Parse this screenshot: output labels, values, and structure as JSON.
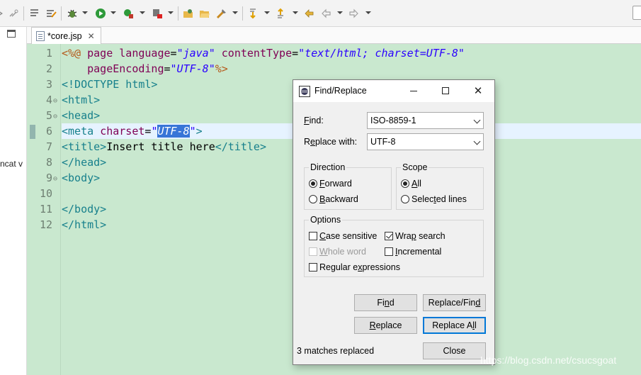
{
  "toolbar": {
    "icons": [
      "collapse-icon",
      "link-icon",
      "outline-icon",
      "task-icon",
      "debug-icon",
      "run-icon",
      "external-run-icon",
      "stop-server-icon",
      "open-type-icon",
      "open-folder-icon",
      "run-ant-icon",
      "next-annotation-icon",
      "prev-annotation-icon",
      "last-edit-icon",
      "back-icon",
      "forward-icon"
    ]
  },
  "left_panel": {
    "partial_text": "ncat v"
  },
  "editor": {
    "tab_label": "*core.jsp",
    "line_numbers": [
      "1",
      "2",
      "3",
      "4",
      "5",
      "6",
      "7",
      "8",
      "9",
      "10",
      "11",
      "12"
    ],
    "lines": {
      "l1": {
        "a": "<%@ ",
        "b": "page ",
        "c": "language",
        "d": "=",
        "e": "\"java\"",
        "f": " contentType",
        "g": "=",
        "h": "\"text/html; charset=UTF-8\""
      },
      "l2": {
        "a": "    pageEncoding",
        "b": "=",
        "c": "\"UTF-8\"",
        "d": "%>"
      },
      "l3": {
        "a": "<!DOCTYPE html>"
      },
      "l4": {
        "a": "<html>"
      },
      "l5": {
        "a": "<head>"
      },
      "l6": {
        "a": "<meta ",
        "b": "charset",
        "c": "=",
        "d": "\"",
        "sel": "UTF-8",
        "e": "\"",
        "f": ">"
      },
      "l7": {
        "a": "<title>",
        "b": "Insert title here",
        "c": "</title>"
      },
      "l8": {
        "a": "</head>"
      },
      "l9": {
        "a": "<body>"
      },
      "l11": {
        "a": "</body>"
      },
      "l12": {
        "a": "</html>"
      }
    }
  },
  "dialog": {
    "title": "Find/Replace",
    "find_label_u": "F",
    "find_label_rest": "ind:",
    "find_value": "ISO-8859-1",
    "replace_label_pre": "R",
    "replace_label_u": "e",
    "replace_label_rest": "place with:",
    "replace_value": "UTF-8",
    "direction": {
      "title": "Direction",
      "forward_u": "F",
      "forward_rest": "orward",
      "backward_u": "B",
      "backward_rest": "ackward"
    },
    "scope": {
      "title": "Scope",
      "all_u": "A",
      "all_rest": "ll",
      "selected_pre": "Selec",
      "selected_u": "t",
      "selected_rest": "ed lines"
    },
    "options": {
      "title": "Options",
      "case_u": "C",
      "case_rest": "ase sensitive",
      "wrap_pre": "Wra",
      "wrap_u": "p",
      "wrap_rest": " search",
      "whole_u": "W",
      "whole_rest": "hole word",
      "incremental_u": "I",
      "incremental_rest": "ncremental",
      "regex_pre": "Regular e",
      "regex_u": "x",
      "regex_rest": "pressions"
    },
    "buttons": {
      "find_pre": "Fi",
      "find_u": "n",
      "find_rest": "d",
      "replace_find_pre": "Replace/Fin",
      "replace_find_u": "d",
      "replace_u": "R",
      "replace_rest": "eplace",
      "replace_all_pre": "Replace A",
      "replace_all_u": "l",
      "replace_all_rest": "l",
      "close": "Close"
    },
    "status": "3 matches replaced"
  },
  "watermark": "https://blog.csdn.net/csucsgoat"
}
